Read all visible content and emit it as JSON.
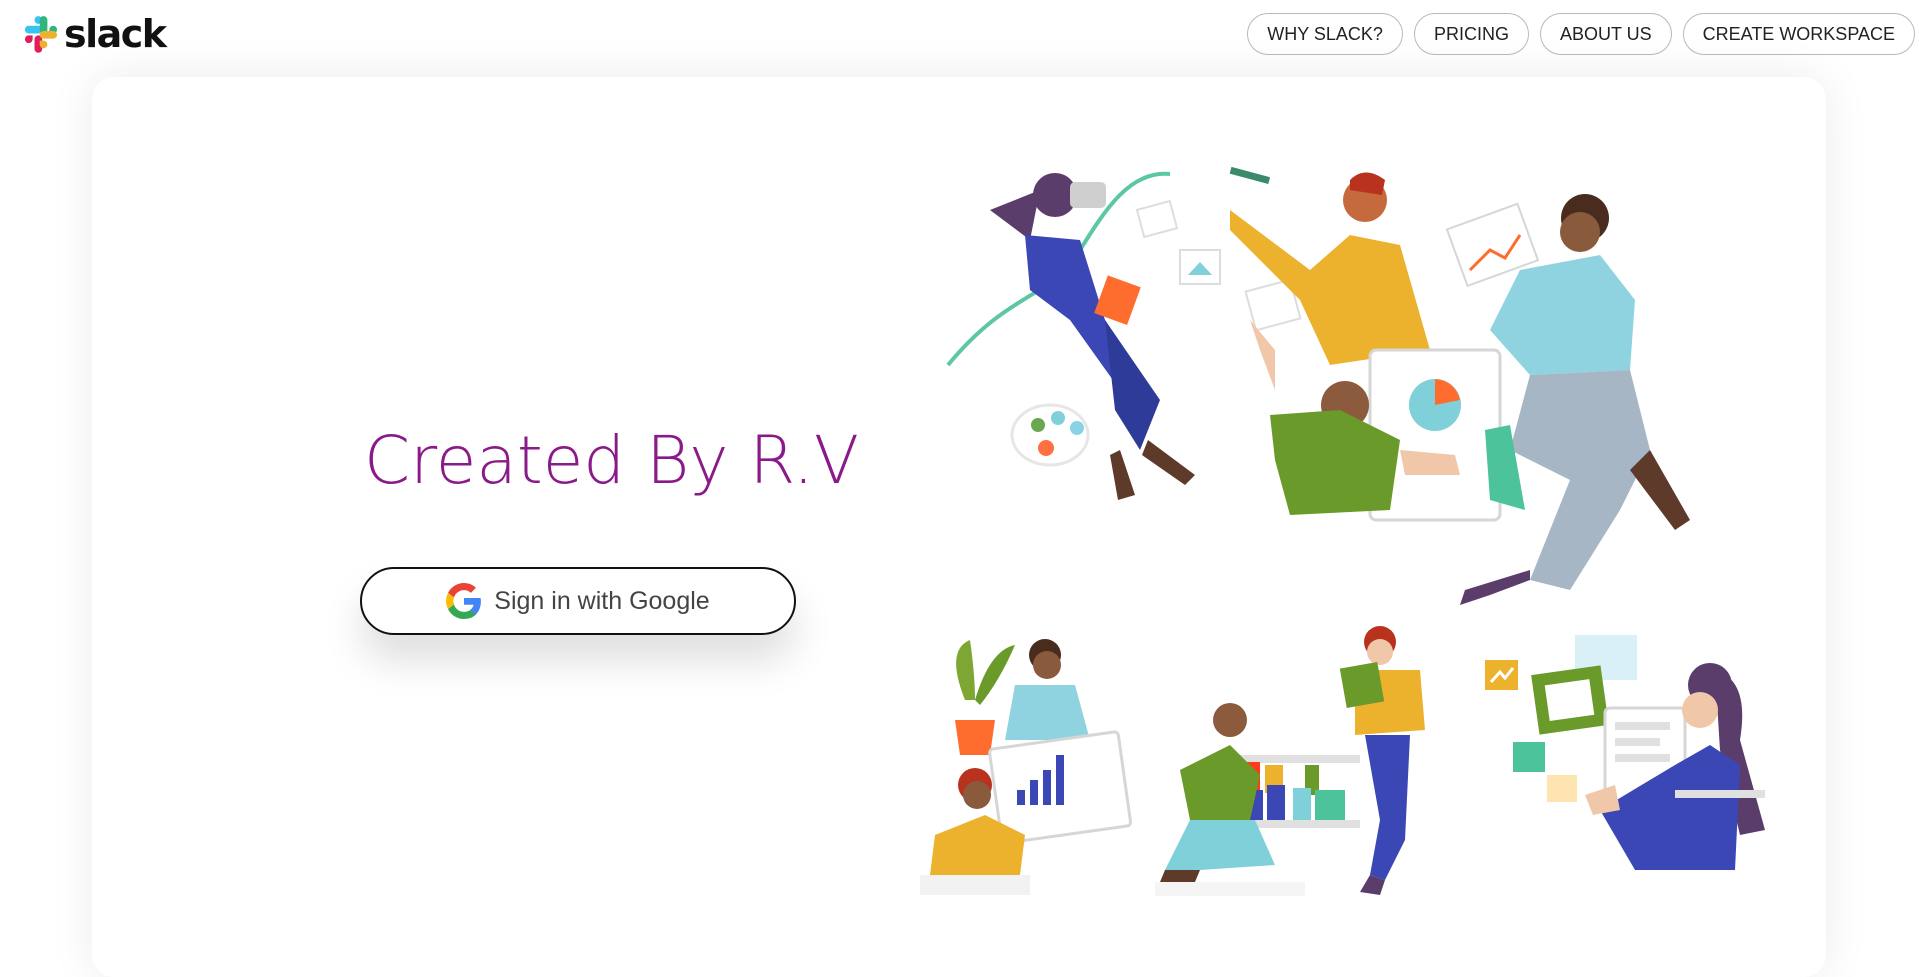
{
  "brand": {
    "name": "slack",
    "colors": {
      "blue": "#36C5F0",
      "green": "#2EB67D",
      "yellow": "#ECB22E",
      "red": "#E01E5A"
    }
  },
  "nav": {
    "items": [
      {
        "label": "WHY SLACK?"
      },
      {
        "label": "PRICING"
      },
      {
        "label": "ABOUT US"
      },
      {
        "label": "CREATE WORKSPACE"
      }
    ]
  },
  "hero": {
    "headline": "Created By R.V",
    "headline_color": "#8a1a89",
    "signin_label": "Sign in with Google",
    "signin_icon": "google-g-icon"
  },
  "illustrations": {
    "top": "team-collaboration-illustration",
    "bottom": [
      "desk-meeting-illustration",
      "bookshelf-illustration",
      "dashboard-illustration"
    ]
  }
}
